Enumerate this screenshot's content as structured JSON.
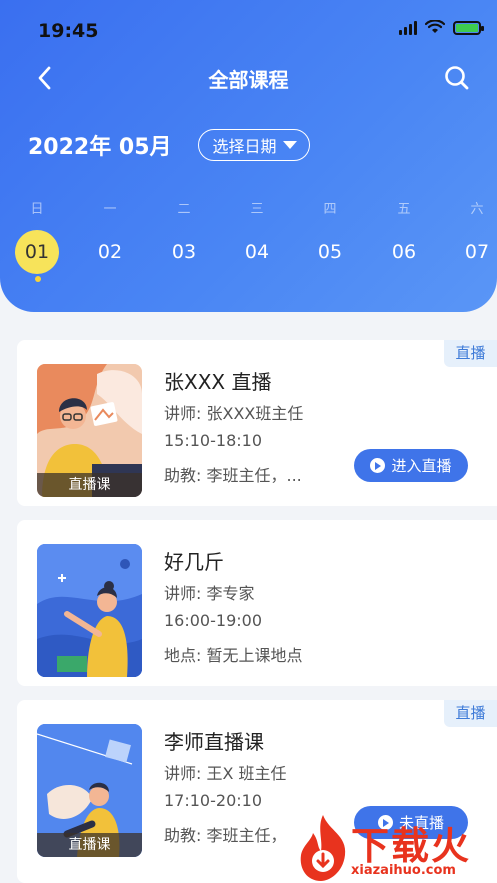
{
  "status": {
    "time": "19:45"
  },
  "nav": {
    "title": "全部课程"
  },
  "calendar": {
    "month": "2022年 05月",
    "picker_label": "选择日期",
    "weekdays": [
      "日",
      "一",
      "二",
      "三",
      "四",
      "五",
      "六"
    ],
    "days": [
      "01",
      "02",
      "03",
      "04",
      "05",
      "06",
      "07"
    ],
    "selected_day": "01"
  },
  "courses": [
    {
      "tag": "直播",
      "title": "张XXX 直播",
      "teacher": "讲师: 张XXX班主任",
      "time": "15:10-18:10",
      "extra": "助教: 李班主任，...",
      "ribbon": "直播课",
      "button": "进入直播"
    },
    {
      "tag": "",
      "title": "好几斤",
      "teacher": "讲师: 李专家",
      "time": "16:00-19:00",
      "extra": "地点: 暂无上课地点",
      "ribbon": "",
      "button": ""
    },
    {
      "tag": "直播",
      "title": "李师直播课",
      "teacher": "讲师: 王X 班主任",
      "time": "17:10-20:10",
      "extra": "助教: 李班主任，",
      "ribbon": "直播课",
      "button": "未直播"
    }
  ],
  "watermark": {
    "text": "下载火",
    "sub": "xiazaihuo.com"
  },
  "colors": {
    "header": "#3f74e9",
    "selected_day": "#f7e35a",
    "tag_bg": "#e6f0fb",
    "button": "#3f74e9"
  }
}
